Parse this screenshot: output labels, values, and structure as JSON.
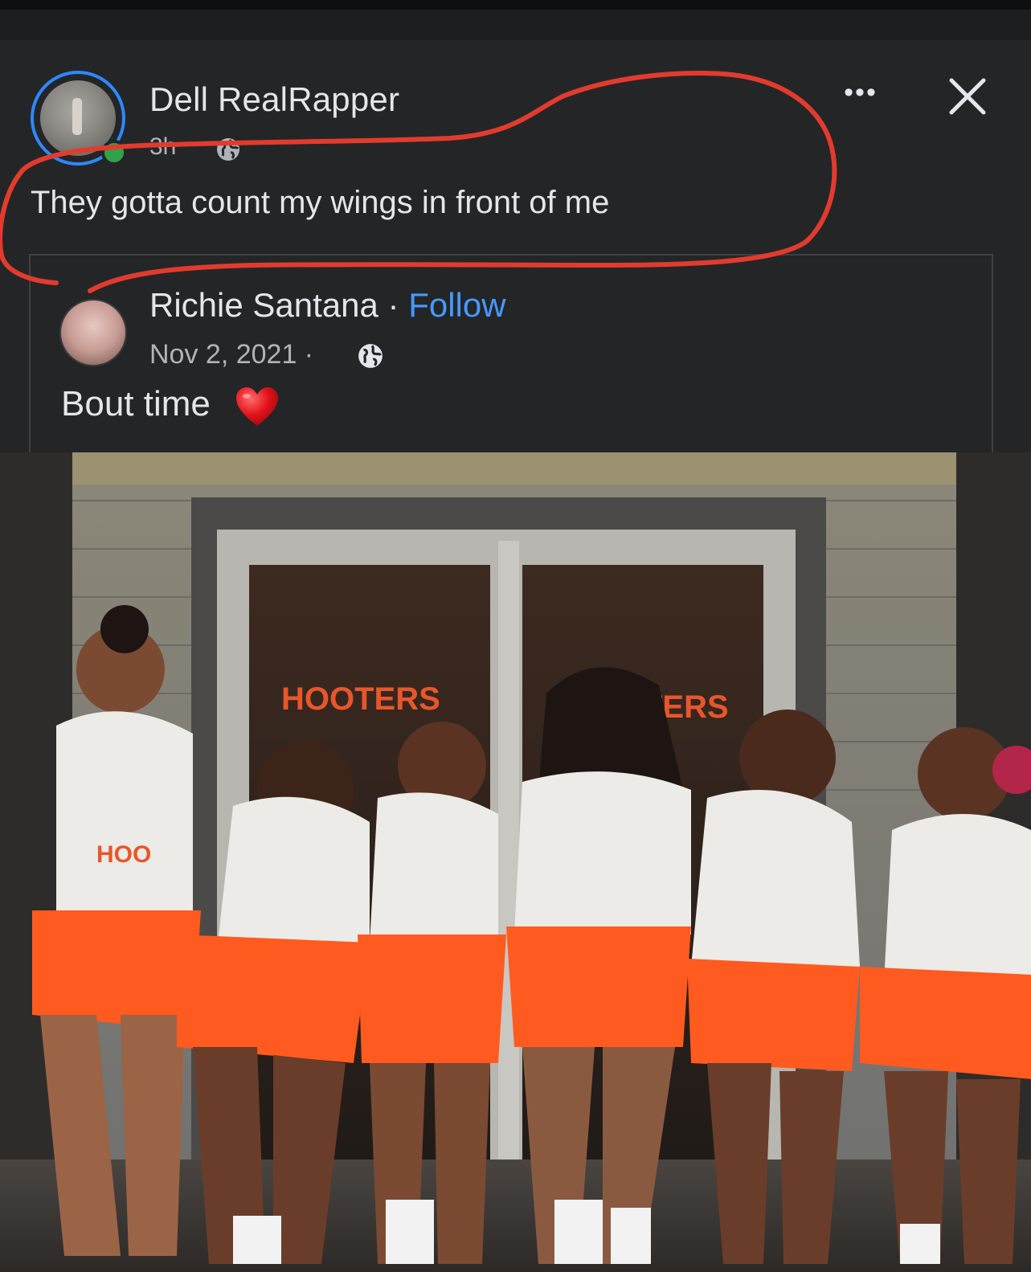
{
  "post": {
    "author": "Dell RealRapper",
    "time": "3h",
    "text": "They gotta count my wings in front of me",
    "more_label": "•••",
    "close_label": "✕"
  },
  "shared": {
    "author": "Richie Santana",
    "separator": " · ",
    "follow": "Follow",
    "date": "Nov 2, 2021 ·",
    "text": "Bout time"
  },
  "photo": {
    "sign_left": "HOOTERS",
    "sign_right": "TERS",
    "shirt_text": "HOO"
  },
  "colors": {
    "background": "#242526",
    "text": "#e4e6eb",
    "secondary_text": "#b0b3b8",
    "link": "#4599ff",
    "annotation": "#e23b2e",
    "shorts": "#ff5a1f"
  },
  "icons": [
    "globe-icon",
    "more-icon",
    "close-icon",
    "heart-emoji-icon",
    "online-status-icon"
  ]
}
